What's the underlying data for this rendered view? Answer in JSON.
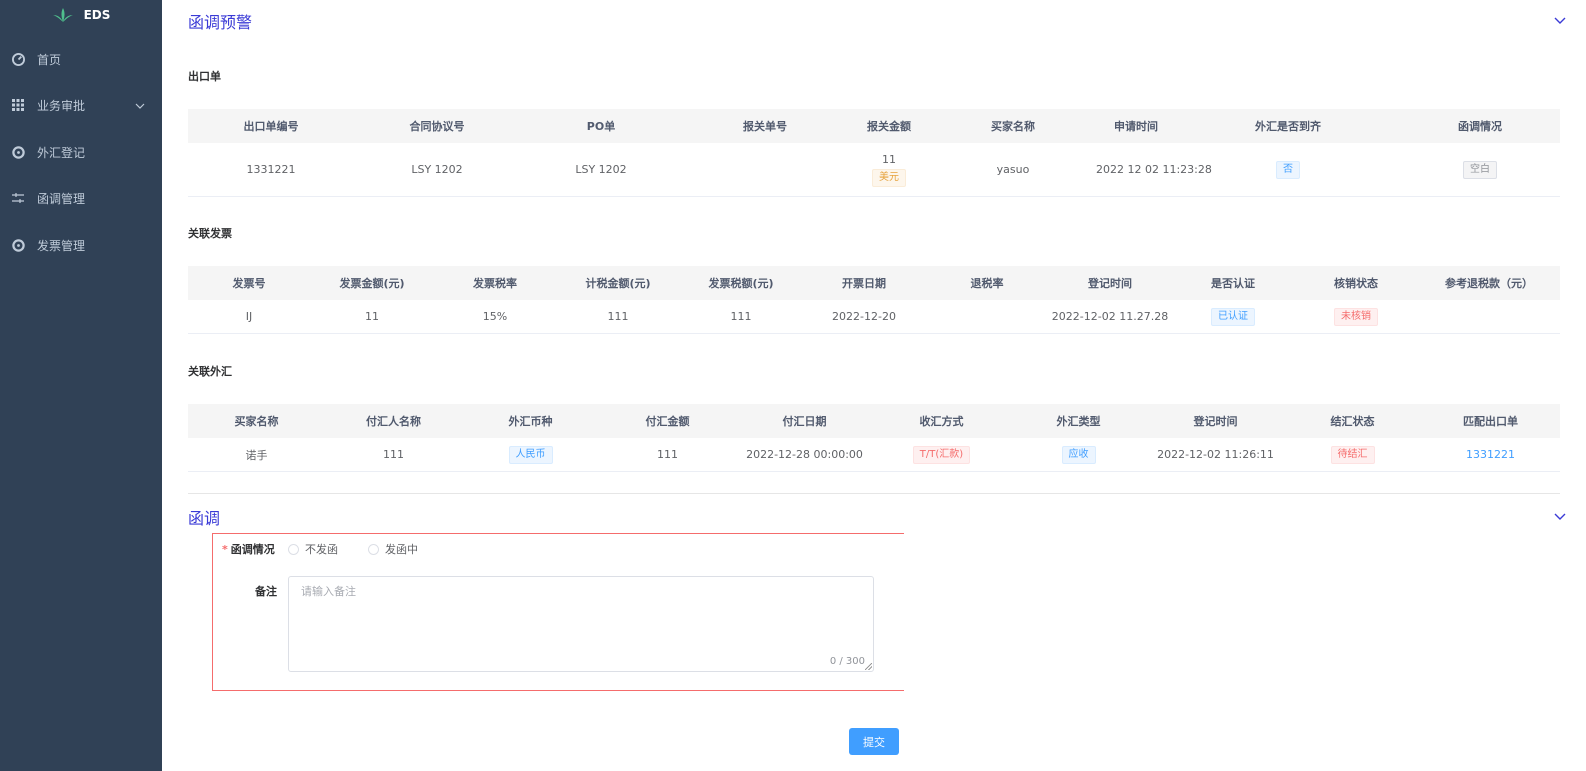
{
  "app": {
    "logo_text": "EDS"
  },
  "sidebar": {
    "items": [
      {
        "label": "首页",
        "icon": "dashboard-icon"
      },
      {
        "label": "业务审批",
        "icon": "grid-icon",
        "has_submenu": true
      },
      {
        "label": "外汇登记",
        "icon": "target-icon"
      },
      {
        "label": "函调管理",
        "icon": "sliders-icon"
      },
      {
        "label": "发票管理",
        "icon": "target-icon"
      }
    ]
  },
  "section_warning": {
    "title": "函调预警",
    "export_title": "出口单",
    "export_headers": [
      "出口单编号",
      "合同协议号",
      "PO单",
      "报关单号",
      "报关金额",
      "买家名称",
      "申请时间",
      "外汇是否到齐",
      "函调情况"
    ],
    "export_row": {
      "no": "1331221",
      "contract": "LSY 1202",
      "po": "LSY 1202",
      "customs_no": "",
      "amount": "11",
      "currency": "美元",
      "buyer": "yasuo",
      "apply_time": "2022 12 02 11:23:28",
      "fx_complete": "否",
      "letter_status": "空白"
    },
    "invoice_title": "关联发票",
    "invoice_headers": [
      "发票号",
      "发票金额(元)",
      "发票税率",
      "计税金额(元)",
      "发票税额(元)",
      "开票日期",
      "退税率",
      "登记时间",
      "是否认证",
      "核销状态",
      "参考退税款（元）"
    ],
    "invoice_row": {
      "no": "IJ",
      "amount": "11",
      "tax_rate": "15%",
      "taxable": "111",
      "tax": "111",
      "date": "2022-12-20",
      "refund_rate": "",
      "reg_time": "2022-12-02 11.27.28",
      "certified": "已认证",
      "writeoff": "未核销",
      "refund": ""
    },
    "fx_title": "关联外汇",
    "fx_headers": [
      "买家名称",
      "付汇人名称",
      "外汇币种",
      "付汇金额",
      "付汇日期",
      "收汇方式",
      "外汇类型",
      "登记时间",
      "结汇状态",
      "匹配出口单"
    ],
    "fx_row": {
      "buyer": "诺手",
      "payer": "111",
      "currency": "人民币",
      "amount": "111",
      "date": "2022-12-28 00:00:00",
      "method": "T/T(汇款)",
      "type": "应收",
      "reg_time": "2022-12-02 11:26:11",
      "settle": "待结汇",
      "match": "1331221"
    }
  },
  "section_letter": {
    "title": "函调",
    "status_label": "函调情况",
    "options": [
      "不发函",
      "发函中"
    ],
    "remark_label": "备注",
    "remark_placeholder": "请输入备注",
    "remark_count": "0 / 300",
    "submit_label": "提交"
  },
  "colors": {
    "sidebar_bg": "#304156",
    "primary": "#409eff",
    "title_blue": "#3a3ad6",
    "error_red": "#f56c6c"
  }
}
